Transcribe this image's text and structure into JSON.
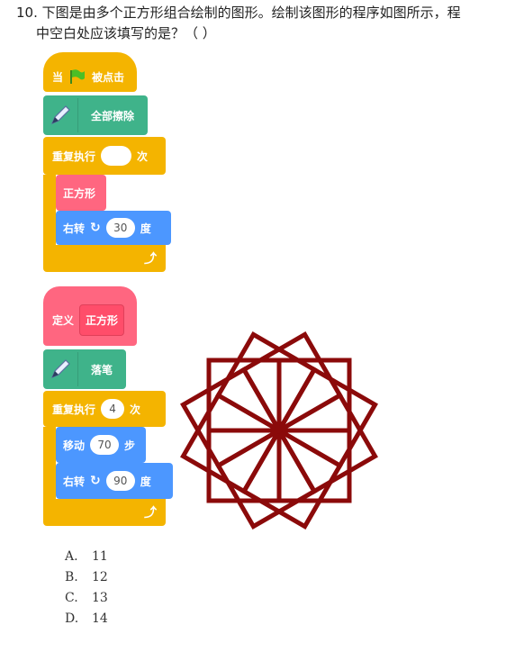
{
  "question": {
    "line1": "10. 下图是由多个正方形组合绘制的图形。绘制该图形的程序如图所示，程",
    "line2": "中空白处应该填写的是？（ ）"
  },
  "script1": {
    "hat": {
      "prefix": "当",
      "suffix": "被点击"
    },
    "erase_all": "全部擦除",
    "repeat": {
      "label": "重复执行",
      "value": "",
      "suffix": "次"
    },
    "call_square": "正方形",
    "turn": {
      "label": "右转",
      "value": "30",
      "suffix": "度"
    }
  },
  "script2": {
    "define": {
      "label": "定义",
      "name": "正方形"
    },
    "pen_down": "落笔",
    "repeat": {
      "label": "重复执行",
      "value": "4",
      "suffix": "次"
    },
    "move": {
      "label": "移动",
      "value": "70",
      "suffix": "步"
    },
    "turn": {
      "label": "右转",
      "value": "90",
      "suffix": "度"
    }
  },
  "figure": {
    "color": "#8b0a0a",
    "square_count": 12,
    "rotation_step_deg": 30
  },
  "colors": {
    "events": "#f4b400",
    "pen": "#3fb38a",
    "custom": "#ff6680",
    "motion": "#4c97ff"
  },
  "options": [
    {
      "letter": "A.",
      "value": "11"
    },
    {
      "letter": "B.",
      "value": "12"
    },
    {
      "letter": "C.",
      "value": "13"
    },
    {
      "letter": "D.",
      "value": "14"
    }
  ]
}
